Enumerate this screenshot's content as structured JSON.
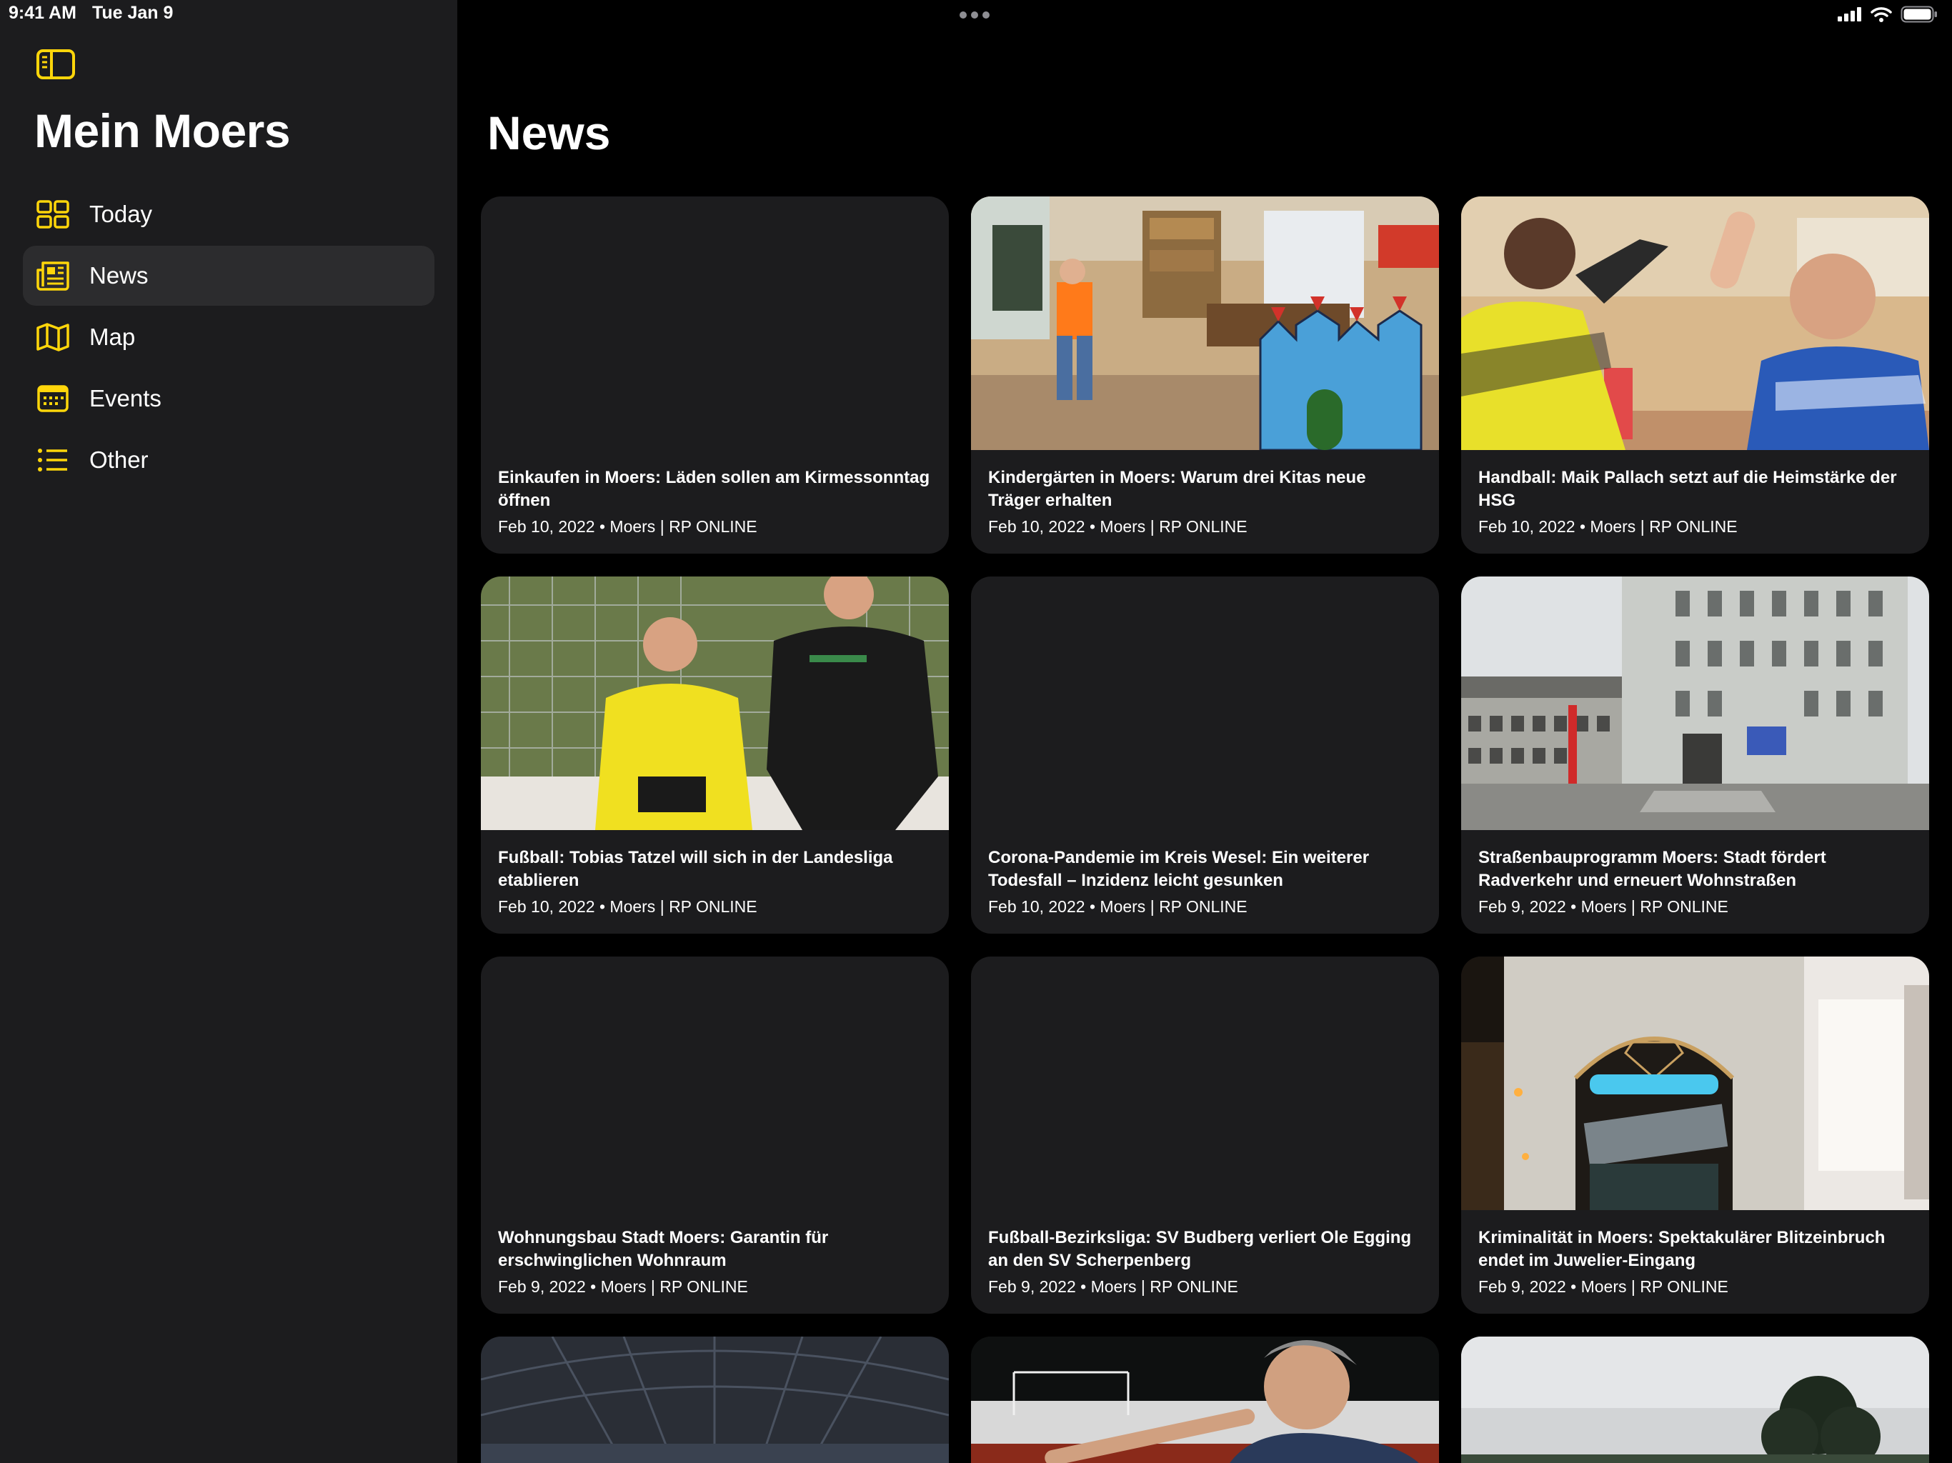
{
  "status": {
    "time": "9:41 AM",
    "date": "Tue Jan 9"
  },
  "sidebar": {
    "title": "Mein Moers",
    "toggle_icon": "sidebar-toggle-icon",
    "items": [
      {
        "label": "Today",
        "icon": "grid-icon",
        "selected": false
      },
      {
        "label": "News",
        "icon": "newspaper-icon",
        "selected": true
      },
      {
        "label": "Map",
        "icon": "map-icon",
        "selected": false
      },
      {
        "label": "Events",
        "icon": "calendar-icon",
        "selected": false
      },
      {
        "label": "Other",
        "icon": "list-icon",
        "selected": false
      }
    ]
  },
  "main": {
    "title": "News",
    "articles": [
      {
        "title": "Einkaufen in Moers: Läden sollen am Kirmessonntag öffnen",
        "date": "Feb 10, 2022",
        "source": "Moers | RP ONLINE",
        "has_image": false
      },
      {
        "title": "Kindergärten in Moers: Warum drei Kitas neue Träger erhalten",
        "date": "Feb 10, 2022",
        "source": "Moers | RP ONLINE",
        "has_image": true
      },
      {
        "title": "Handball: Maik Pallach setzt auf die Heimstärke der HSG",
        "date": "Feb 10, 2022",
        "source": "Moers | RP ONLINE",
        "has_image": true
      },
      {
        "title": "Fußball: Tobias Tatzel will sich in der Landesliga etablieren",
        "date": "Feb 10, 2022",
        "source": "Moers | RP ONLINE",
        "has_image": true
      },
      {
        "title": "Corona-Pandemie im Kreis Wesel: Ein weiterer Todesfall – Inzidenz leicht gesunken",
        "date": "Feb 10, 2022",
        "source": "Moers | RP ONLINE",
        "has_image": false
      },
      {
        "title": "Straßenbauprogramm Moers: Stadt fördert Radverkehr und erneuert Wohnstraßen",
        "date": "Feb 9, 2022",
        "source": "Moers | RP ONLINE",
        "has_image": true
      },
      {
        "title": "Wohnungsbau Stadt Moers: Garantin für erschwinglichen Wohnraum",
        "date": "Feb 9, 2022",
        "source": "Moers | RP ONLINE",
        "has_image": false
      },
      {
        "title": "Fußball-Bezirksliga: SV Budberg verliert Ole Egging an den SV Scherpenberg",
        "date": "Feb 9, 2022",
        "source": "Moers | RP ONLINE",
        "has_image": false
      },
      {
        "title": "Kriminalität in Moers: Spektakulärer Blitzeinbruch endet im Juwelier-Eingang",
        "date": "Feb 9, 2022",
        "source": "Moers | RP ONLINE",
        "has_image": true
      }
    ],
    "meta_separator": "•"
  },
  "colors": {
    "accent": "#ffd60a",
    "sidebar_bg": "#1c1c1e",
    "selected_bg": "#2c2c2e",
    "card_bg": "#1c1c1e",
    "background": "#000000"
  }
}
